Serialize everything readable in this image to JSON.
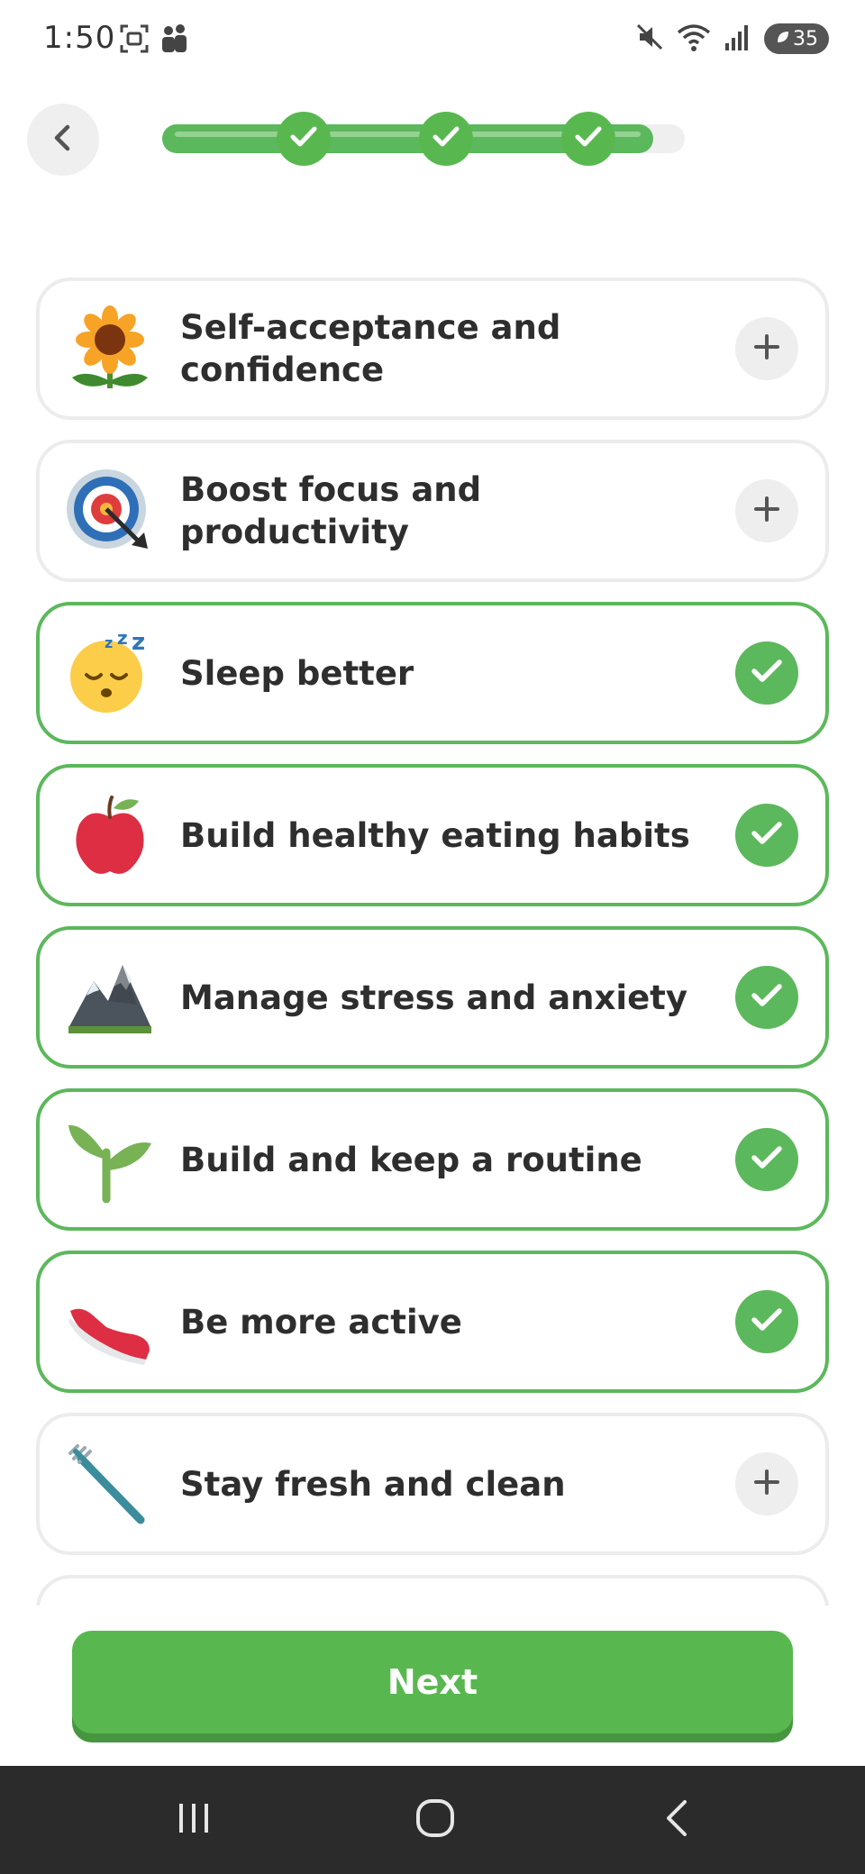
{
  "status_bar": {
    "time": "1:50",
    "battery_level": "35"
  },
  "header": {
    "progress_fraction": 0.94,
    "completed_steps": 3
  },
  "goals": [
    {
      "label": "Self-acceptance and confidence",
      "icon": "sunflower-icon",
      "selected": false
    },
    {
      "label": "Boost focus and productivity",
      "icon": "target-icon",
      "selected": false
    },
    {
      "label": "Sleep better",
      "icon": "sleeping-face-icon",
      "selected": true
    },
    {
      "label": "Build healthy eating habits",
      "icon": "apple-icon",
      "selected": true
    },
    {
      "label": "Manage stress and anxiety",
      "icon": "mountain-icon",
      "selected": true
    },
    {
      "label": "Build and keep a routine",
      "icon": "seedling-icon",
      "selected": true
    },
    {
      "label": "Be more active",
      "icon": "sneaker-icon",
      "selected": true
    },
    {
      "label": "Stay fresh and clean",
      "icon": "toothbrush-icon",
      "selected": false
    }
  ],
  "footer": {
    "next_label": "Next"
  },
  "colors": {
    "accent": "#5cb85c",
    "card_border": "#ececec",
    "nav_bar": "#2b2b2b"
  }
}
